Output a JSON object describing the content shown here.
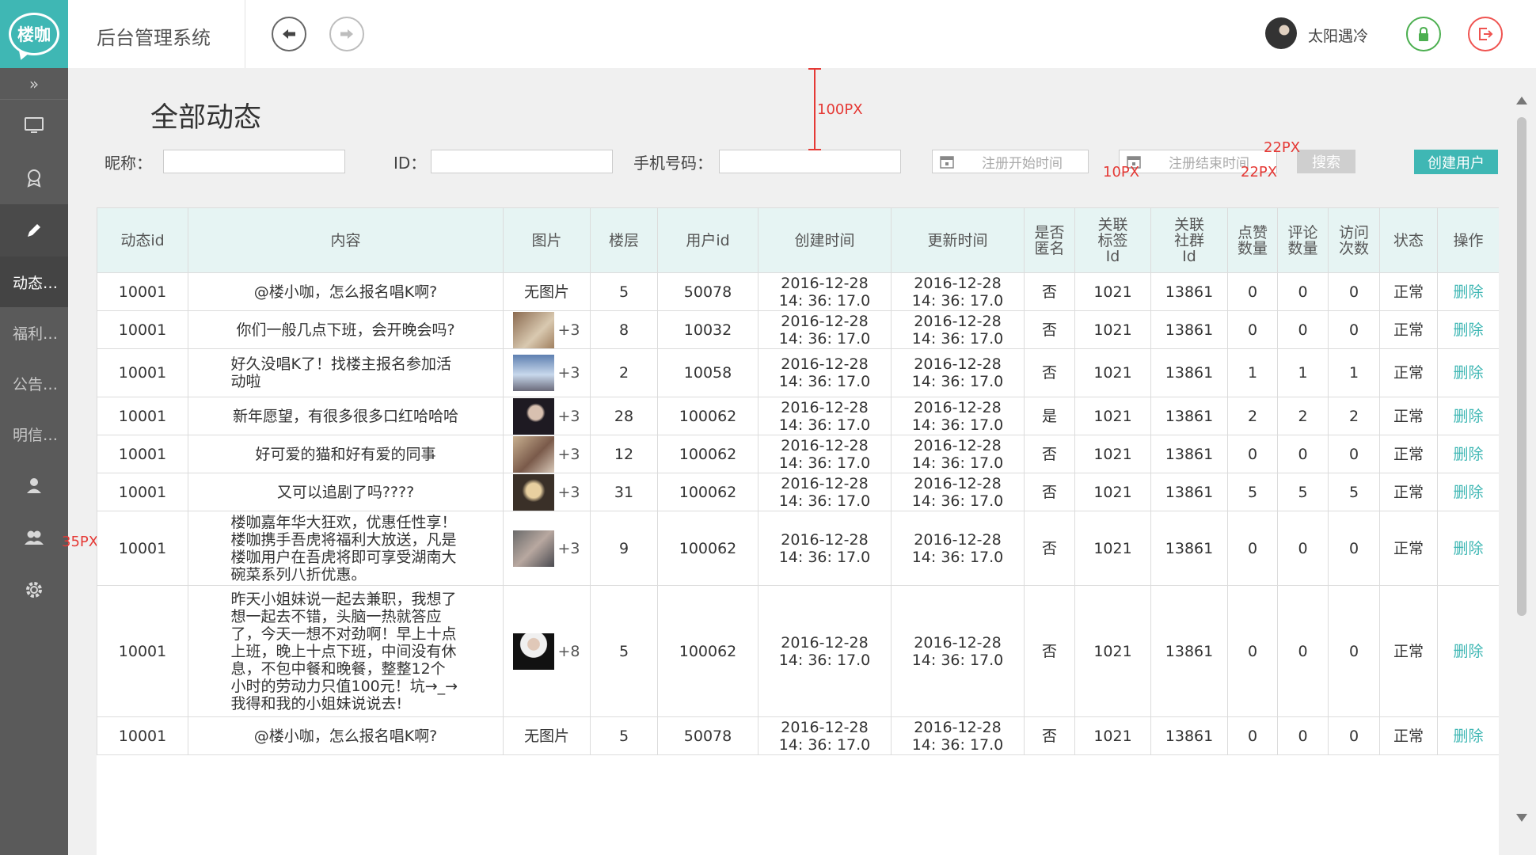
{
  "app": {
    "logo_text": "楼咖",
    "title": "后台管理系统",
    "user_name": "太阳遇冷"
  },
  "sidebar": {
    "collapse_label": "»",
    "items": [
      {
        "label": "动态…"
      },
      {
        "label": "福利…"
      },
      {
        "label": "公告…"
      },
      {
        "label": "明信…"
      }
    ]
  },
  "page": {
    "title": "全部动态"
  },
  "filters": {
    "nickname_label": "昵称：",
    "id_label": "ID：",
    "phone_label": "手机号码：",
    "start_date_placeholder": "注册开始时间",
    "end_date_placeholder": "注册结束时间",
    "search_label": "搜索",
    "create_label": "创建用户"
  },
  "annotations": {
    "a100": "100PX",
    "a22a": "22PX",
    "a10": "10PX",
    "a22b": "22PX",
    "a35": "35PX"
  },
  "table": {
    "headers": [
      "动态id",
      "内容",
      "图片",
      "楼层",
      "用户id",
      "创建时间",
      "更新时间",
      "是否\n匿名",
      "关联\n标签\nId",
      "关联\n社群\nId",
      "点赞\n数量",
      "评论\n数量",
      "访问\n次数",
      "状态",
      "操作"
    ],
    "rows": [
      {
        "id": "10001",
        "content": "@楼小咖，怎么报名唱K啊?",
        "pic": "无图片",
        "floor": "5",
        "uid": "50078",
        "created": "2016-12-28\n14:  36: 17.0",
        "updated": "2016-12-28\n14:  36: 17.0",
        "anon": "否",
        "tag": "1021",
        "group": "13861",
        "likes": "0",
        "comments": "0",
        "visits": "0",
        "status": "正常",
        "action": "删除"
      },
      {
        "id": "10001",
        "content": "你们一般几点下班，会开晚会吗?",
        "pic": "+3",
        "floor": "8",
        "uid": "10032",
        "created": "2016-12-28\n14:  36: 17.0",
        "updated": "2016-12-28\n14:  36: 17.0",
        "anon": "否",
        "tag": "1021",
        "group": "13861",
        "likes": "0",
        "comments": "0",
        "visits": "0",
        "status": "正常",
        "action": "删除"
      },
      {
        "id": "10001",
        "content": "好久没唱K了！找楼主报名参加活动啦",
        "pic": "+3",
        "floor": "2",
        "uid": "10058",
        "created": "2016-12-28\n14:  36: 17.0",
        "updated": "2016-12-28\n14:  36: 17.0",
        "anon": "否",
        "tag": "1021",
        "group": "13861",
        "likes": "1",
        "comments": "1",
        "visits": "1",
        "status": "正常",
        "action": "删除"
      },
      {
        "id": "10001",
        "content": "新年愿望，有很多很多口红哈哈哈",
        "pic": "+3",
        "floor": "28",
        "uid": "100062",
        "created": "2016-12-28\n14:  36: 17.0",
        "updated": "2016-12-28\n14:  36: 17.0",
        "anon": "是",
        "tag": "1021",
        "group": "13861",
        "likes": "2",
        "comments": "2",
        "visits": "2",
        "status": "正常",
        "action": "删除"
      },
      {
        "id": "10001",
        "content": "好可爱的猫和好有爱的同事",
        "pic": "+3",
        "floor": "12",
        "uid": "100062",
        "created": "2016-12-28\n14:  36: 17.0",
        "updated": "2016-12-28\n14:  36: 17.0",
        "anon": "否",
        "tag": "1021",
        "group": "13861",
        "likes": "0",
        "comments": "0",
        "visits": "0",
        "status": "正常",
        "action": "删除"
      },
      {
        "id": "10001",
        "content": "又可以追剧了吗????",
        "pic": "+3",
        "floor": "31",
        "uid": "100062",
        "created": "2016-12-28\n14:  36: 17.0",
        "updated": "2016-12-28\n14:  36: 17.0",
        "anon": "否",
        "tag": "1021",
        "group": "13861",
        "likes": "5",
        "comments": "5",
        "visits": "5",
        "status": "正常",
        "action": "删除"
      },
      {
        "id": "10001",
        "content": "楼咖嘉年华大狂欢，优惠任性享！楼咖携手吾虎将福利大放送，凡是楼咖用户在吾虎将即可享受湖南大碗菜系列八折优惠。",
        "pic": "+3",
        "floor": "9",
        "uid": "100062",
        "created": "2016-12-28\n14:  36: 17.0",
        "updated": "2016-12-28\n14:  36: 17.0",
        "anon": "否",
        "tag": "1021",
        "group": "13861",
        "likes": "0",
        "comments": "0",
        "visits": "0",
        "status": "正常",
        "action": "删除"
      },
      {
        "id": "10001",
        "content": "昨天小姐妹说一起去兼职，我想了想一起去不错，头脑一热就答应了，今天一想不对劲啊！早上十点上班，晚上十点下班，中间没有休息，不包中餐和晚餐，整整12个小时的劳动力只值100元！坑→_→我得和我的小姐妹说说去!",
        "pic": "+8",
        "floor": "5",
        "uid": "100062",
        "created": "2016-12-28\n14:  36: 17.0",
        "updated": "2016-12-28\n14:  36: 17.0",
        "anon": "否",
        "tag": "1021",
        "group": "13861",
        "likes": "0",
        "comments": "0",
        "visits": "0",
        "status": "正常",
        "action": "删除"
      },
      {
        "id": "10001",
        "content": "@楼小咖，怎么报名唱K啊?",
        "pic": "无图片",
        "floor": "5",
        "uid": "50078",
        "created": "2016-12-28\n14:  36: 17.0",
        "updated": "2016-12-28\n14:  36: 17.0",
        "anon": "否",
        "tag": "1021",
        "group": "13861",
        "likes": "0",
        "comments": "0",
        "visits": "0",
        "status": "正常",
        "action": "删除"
      }
    ]
  },
  "icons": {
    "collapse": "double-chevron-right-icon",
    "monitor": "monitor-icon",
    "trophy": "trophy-icon",
    "pencil": "pencil-icon",
    "user": "user-icon",
    "users": "users-icon",
    "gear": "gear-icon",
    "back": "arrow-left-icon",
    "forward": "arrow-right-icon",
    "lock": "lock-icon",
    "logout": "logout-icon",
    "calendar": "calendar-icon"
  },
  "colors": {
    "accent": "#3fb7b4",
    "sidebar": "#5a5a5a",
    "lock": "#4caf50",
    "logout": "#ef5350",
    "annotation": "#e53935"
  }
}
